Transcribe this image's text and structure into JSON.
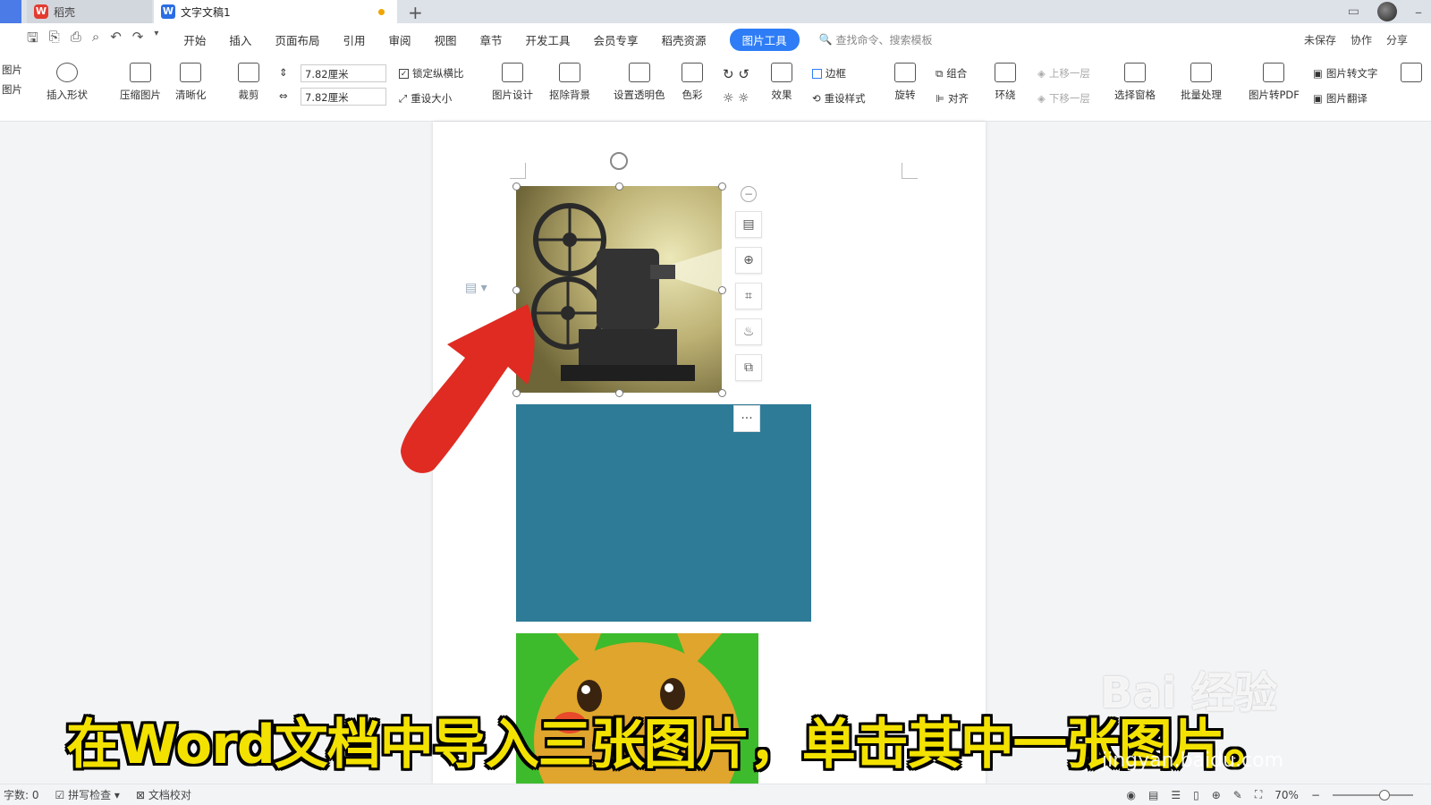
{
  "tabs": {
    "home_label": "稻壳",
    "doc_label": "文字文稿1"
  },
  "menu": {
    "items": [
      "开始",
      "插入",
      "页面布局",
      "引用",
      "审阅",
      "视图",
      "章节",
      "开发工具",
      "会员专享",
      "稻壳资源"
    ],
    "active_tab": "图片工具",
    "search_placeholder": "查找命令、搜索模板",
    "right": [
      "未保存",
      "协作",
      "分享"
    ]
  },
  "ribbon": {
    "insert_picture": "图片",
    "insert_shape": "插入形状",
    "compress": "压缩图片",
    "sharpen": "清晰化",
    "crop": "裁剪",
    "width_value": "7.82厘米",
    "height_value": "7.82厘米",
    "lock_ratio": "锁定纵横比",
    "reset_size": "重设大小",
    "picture_design": "图片设计",
    "remove_bg": "抠除背景",
    "set_transparent": "设置透明色",
    "color": "色彩",
    "effects": "效果",
    "border": "边框",
    "reset_style": "重设样式",
    "rotate": "旋转",
    "group": "组合",
    "align": "对齐",
    "wrap": "环绕",
    "bring_forward": "上移一层",
    "send_backward": "下移一层",
    "selection_pane": "选择窗格",
    "batch": "批量处理",
    "to_pdf": "图片转PDF",
    "to_text": "图片转文字",
    "translate": "图片翻译"
  },
  "status": {
    "word_count": "字数: 0",
    "spell_check": "拼写检查",
    "proofread": "文档校对",
    "zoom": "70%"
  },
  "caption": "在Word文档中导入三张图片，单击其中一张图片。",
  "watermark": {
    "main": "Bai 经验",
    "sub": "jingyan.baidu.com"
  },
  "colors": {
    "accent": "#2e7df6",
    "image2": "#2e7b97",
    "caption": "#f3e200",
    "arrow": "#e02b22"
  }
}
